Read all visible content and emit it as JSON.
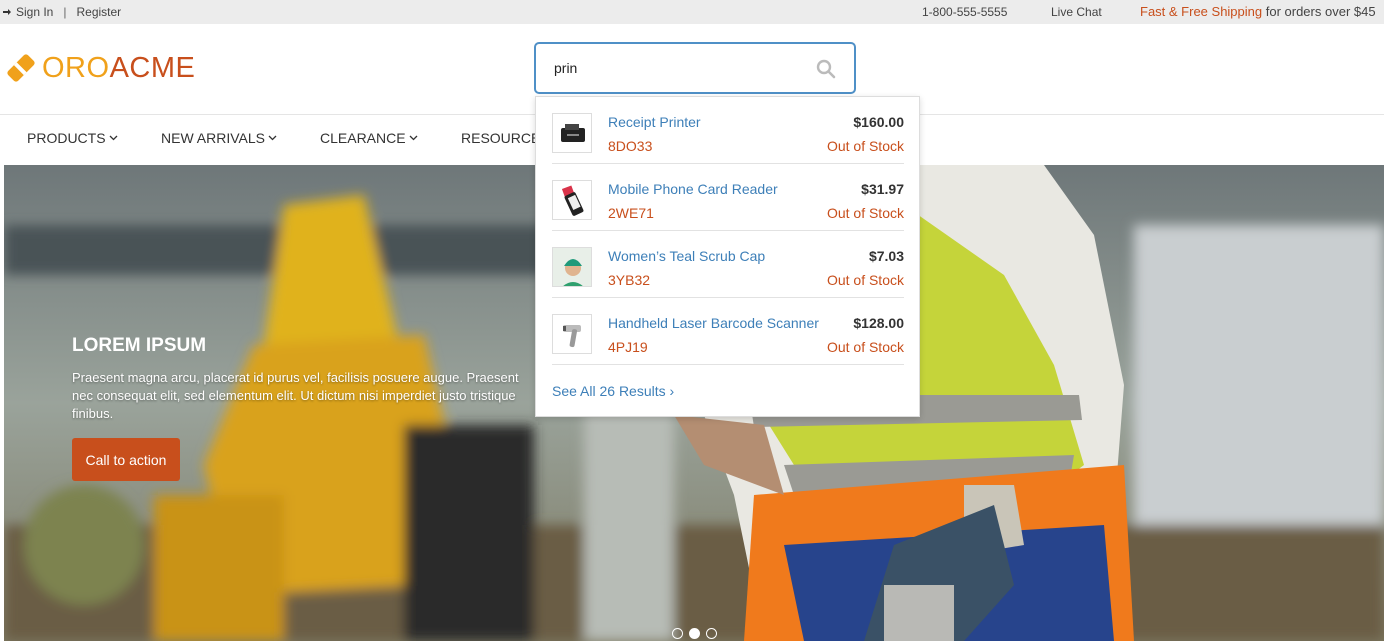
{
  "topbar": {
    "sign_in": "Sign In",
    "separator": "|",
    "register": "Register",
    "phone": "1-800-555-5555",
    "live_chat": "Live Chat",
    "shipping_highlight": "Fast & Free Shipping",
    "shipping_rest": " for orders over $45"
  },
  "logo": {
    "part1": "ORO",
    "part2": "ACME"
  },
  "search": {
    "value": "prin"
  },
  "nav": {
    "items": [
      {
        "label": "PRODUCTS"
      },
      {
        "label": "NEW ARRIVALS"
      },
      {
        "label": "CLEARANCE"
      },
      {
        "label": "RESOURCE"
      }
    ]
  },
  "hero": {
    "title": "LOREM IPSUM",
    "body": "Praesent magna arcu, placerat id purus vel, facilisis posuere augue. Praesent nec consequat elit, sed elementum elit. Ut dictum nisi imperdiet justo tristique finibus.",
    "cta": "Call to action",
    "slides": 3,
    "active_slide": 2
  },
  "autocomplete": {
    "results": [
      {
        "name": "Receipt Printer",
        "sku": "8DO33",
        "price": "$160.00",
        "stock": "Out of Stock",
        "icon": "printer-thumb"
      },
      {
        "name": "Mobile Phone Card Reader",
        "sku": "2WE71",
        "price": "$31.97",
        "stock": "Out of Stock",
        "icon": "card-reader-thumb"
      },
      {
        "name": "Women’s Teal Scrub Cap",
        "sku": "3YB32",
        "price": "$7.03",
        "stock": "Out of Stock",
        "icon": "scrub-cap-thumb"
      },
      {
        "name": "Handheld Laser Barcode Scanner",
        "sku": "4PJ19",
        "price": "$128.00",
        "stock": "Out of Stock",
        "icon": "barcode-scanner-thumb"
      }
    ],
    "see_all": "See All 26 Results",
    "see_all_chevron": "›"
  },
  "colors": {
    "accent_orange": "#c84f1c",
    "logo_yellow": "#f0a11b",
    "link_blue": "#3d7fb8",
    "search_border": "#4f90c7"
  }
}
